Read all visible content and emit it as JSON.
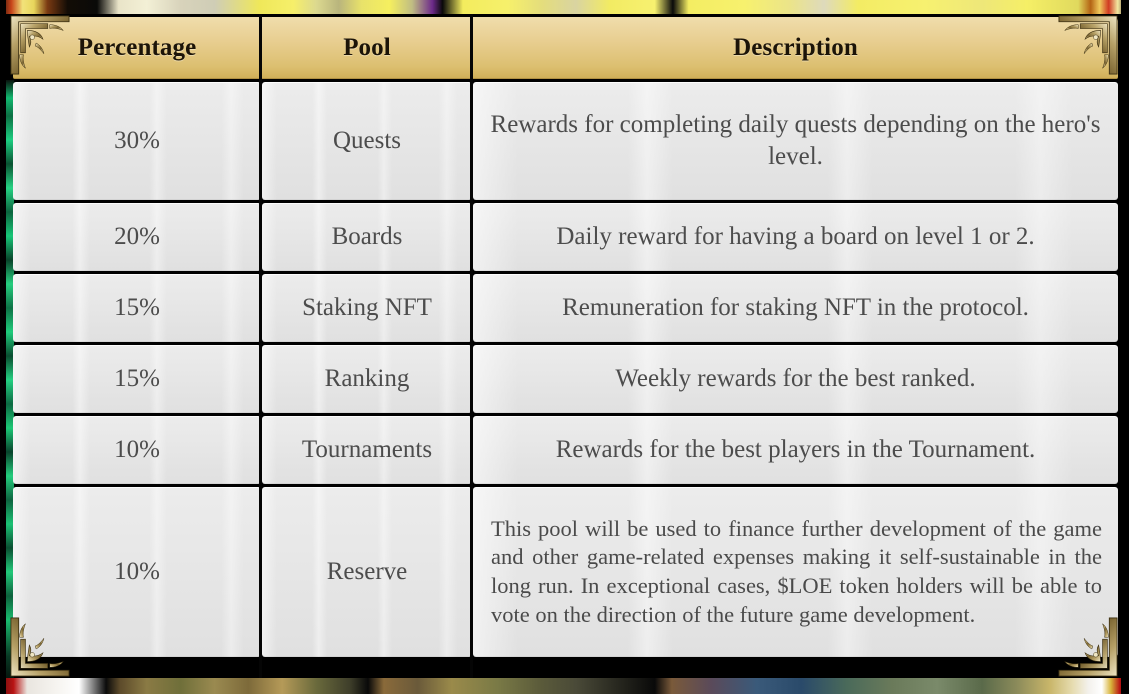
{
  "table": {
    "columns": [
      {
        "key": "percentage",
        "label": "Percentage"
      },
      {
        "key": "pool",
        "label": "Pool"
      },
      {
        "key": "description",
        "label": "Description"
      }
    ],
    "rows": [
      {
        "percentage": "30%",
        "pool": "Quests",
        "description": "Rewards for completing daily quests depending on the hero's level."
      },
      {
        "percentage": "20%",
        "pool": "Boards",
        "description": "Daily reward for having a board on level 1 or 2."
      },
      {
        "percentage": "15%",
        "pool": "Staking NFT",
        "description": "Remuneration for staking NFT in the protocol."
      },
      {
        "percentage": "15%",
        "pool": "Ranking",
        "description": "Weekly rewards for the best ranked."
      },
      {
        "percentage": "10%",
        "pool": "Tournaments",
        "description": "Rewards for the best players in the Tournament."
      },
      {
        "percentage": "10%",
        "pool": "Reserve",
        "description": "This pool will be used to finance further development of the game and other game-related expenses making it self-sustainable in the long run. In exceptional cases, $LOE token holders will be able to vote on the direction of the future game development."
      }
    ]
  },
  "ornaments": {
    "top_left": "corner-flourish-ornament",
    "top_right": "corner-flourish-ornament",
    "bottom_left": "corner-flourish-ornament",
    "bottom_right": "corner-flourish-ornament"
  },
  "colors": {
    "header_gold": "#e3c880",
    "header_gold_light": "#f0ddac",
    "header_gold_dark": "#cfae57",
    "cell_background": "#e8e8e8",
    "cell_text": "#4c4c4c",
    "header_text": "#1c1408",
    "frame_black": "#000000",
    "ornament_gold": "#b39b5e"
  }
}
